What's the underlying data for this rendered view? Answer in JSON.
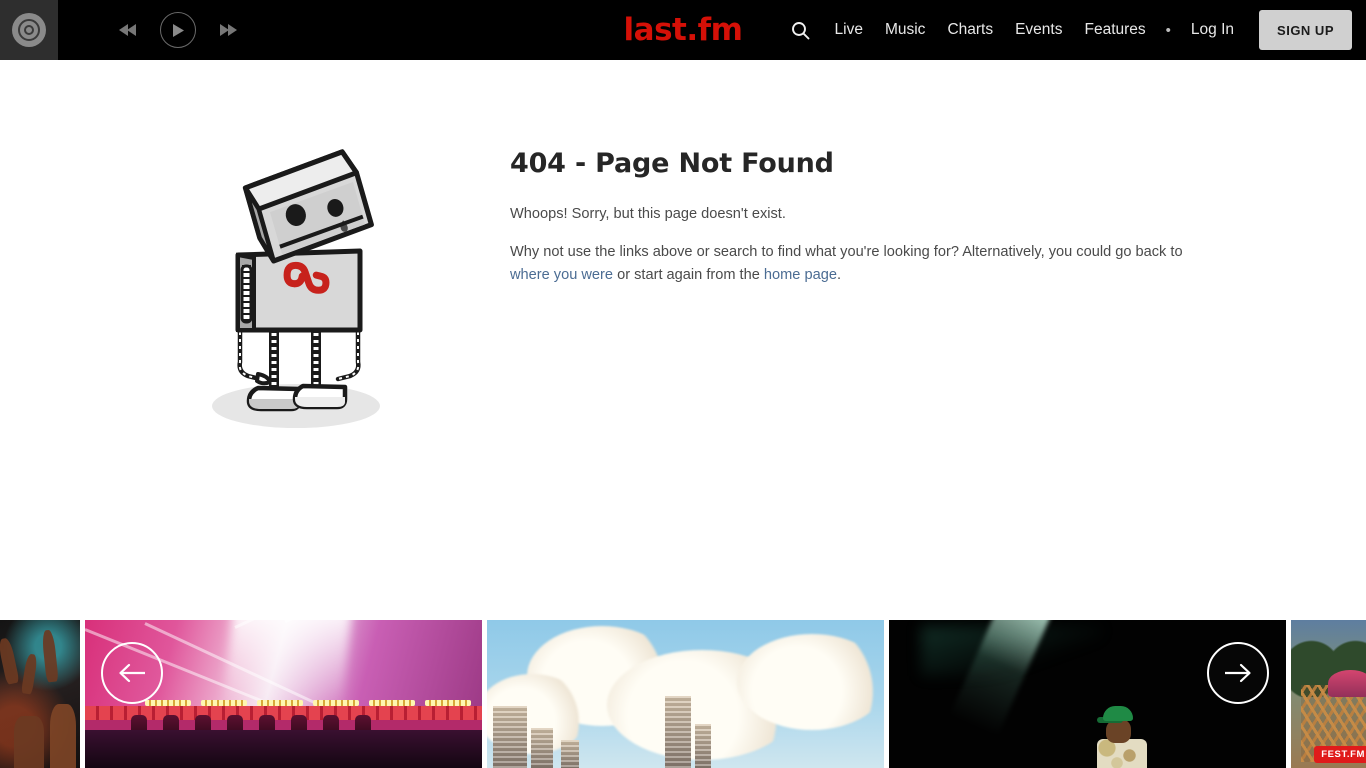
{
  "header": {
    "disc_icon": "vinyl-record-icon",
    "transport": {
      "previous": "previous-track-icon",
      "play": "play-icon",
      "next": "next-track-icon"
    },
    "logo": "last.fm",
    "search_icon": "search-icon",
    "nav_items": [
      {
        "label": "Live"
      },
      {
        "label": "Music"
      },
      {
        "label": "Charts"
      },
      {
        "label": "Events"
      },
      {
        "label": "Features"
      }
    ],
    "separator": "•",
    "login_label": "Log In",
    "signup_label": "SIGN UP",
    "background_color": "#000000",
    "logo_color": "#d51007",
    "signup_bg_color": "#d0d0d0"
  },
  "main": {
    "illustration": "sad-robot-illustration",
    "robot_logo": "as",
    "title": "404 - Page Not Found",
    "paragraph_1": "Whoops! Sorry, but this page doesn't exist.",
    "paragraph_2": {
      "part_1": "Why not use the links above or search to find what you're looking for? Alternatively, you could go back to ",
      "link_1": "where you were",
      "part_2": " or start again from the ",
      "link_2": "home page",
      "part_3": "."
    },
    "link_color": "#4b6c93",
    "title_color": "#262626",
    "text_color": "#4a4a4a"
  },
  "carousel": {
    "prev_icon": "arrow-left-icon",
    "next_icon": "arrow-right-icon",
    "slides": [
      {
        "name": "crowd-photo"
      },
      {
        "name": "pink-stage-tent-photo"
      },
      {
        "name": "city-skyline-clouds-photo"
      },
      {
        "name": "dark-stage-performer-photo"
      },
      {
        "name": "festival-photo"
      }
    ],
    "badge_label": "FEST.FM",
    "badge_color": "#e01b1b"
  }
}
